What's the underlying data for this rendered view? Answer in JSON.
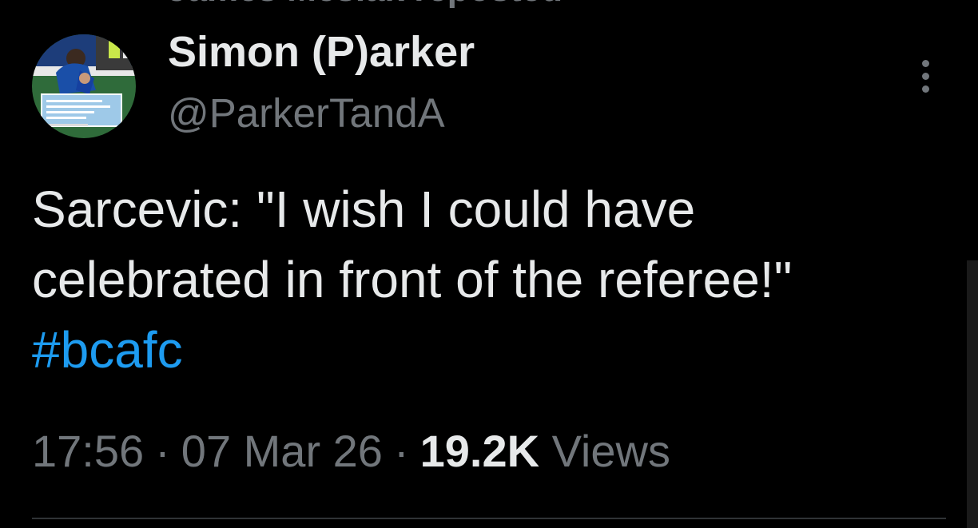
{
  "social_context": {
    "label": "James Mesiak reposted"
  },
  "author": {
    "display_name": "Simon (P)arker",
    "handle": "@ParkerTandA"
  },
  "tweet": {
    "text_line1": "Sarcevic: \"I wish I could have",
    "text_line2": "celebrated in front of the referee!\"",
    "hashtag": "#bcafc"
  },
  "meta": {
    "time": "17:56",
    "date": "07 Mar 26",
    "separator": "·",
    "views_count": "19.2K",
    "views_label": "Views"
  },
  "icons": {
    "more": "more-vertical-icon"
  },
  "colors": {
    "background": "#000000",
    "primary_text": "#e7e9ea",
    "secondary_text": "#71767b",
    "link": "#1d9bf0",
    "divider": "#2f3336"
  }
}
